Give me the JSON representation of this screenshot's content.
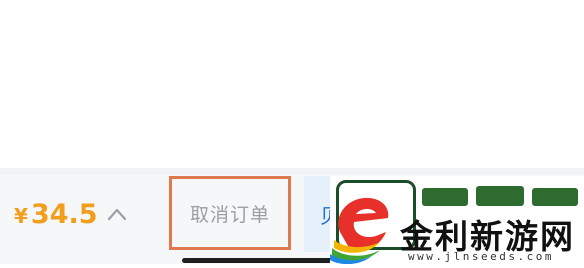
{
  "order": {
    "currency_symbol": "¥",
    "total_price": "34.5",
    "cancel_label": "取消订单",
    "next_label_partial": "贝"
  },
  "watermark": {
    "title": "金利新游网",
    "url": "www.jlnseeds.com"
  },
  "colors": {
    "price": "#f39d1c",
    "cancel_text": "#9aa0a6",
    "highlight_border": "#e07a4e",
    "next_bg": "#e6f0fb",
    "bar_bg": "#f6f7f9"
  },
  "icons": {
    "expand": "chevron-up-icon",
    "logo": "site-logo-icon"
  }
}
